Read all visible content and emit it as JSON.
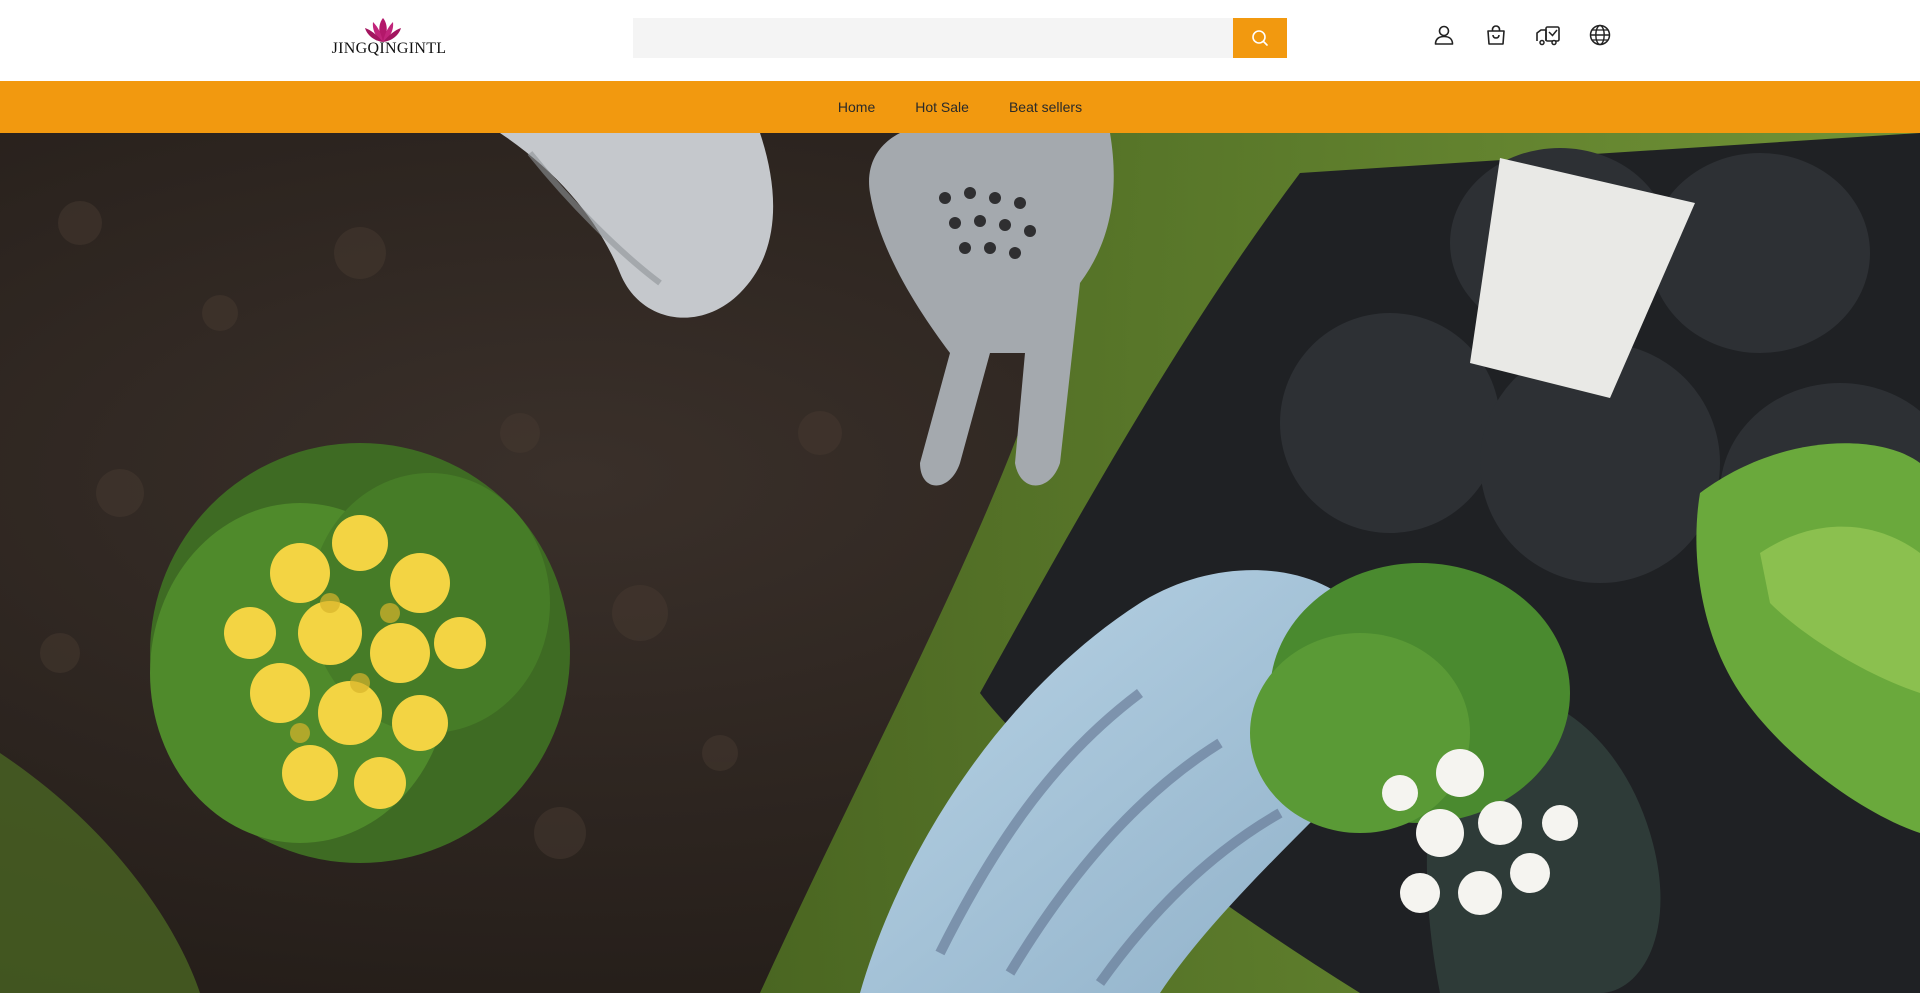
{
  "brand": {
    "logo_text": "JINGQINGINTL",
    "accent_color": "#f2990f",
    "logo_color": "#b3186a"
  },
  "search": {
    "placeholder": "",
    "value": "",
    "button_icon": "search-icon"
  },
  "header_icons": [
    "user-icon",
    "cart-icon",
    "tracking-icon",
    "globe-icon"
  ],
  "nav": {
    "items": [
      {
        "label": "Home"
      },
      {
        "label": "Hot Sale"
      },
      {
        "label": "Beat sellers"
      }
    ]
  },
  "hero": {
    "image_subject": "hero-banner-gardening",
    "dominant_colors": [
      "#2a231f",
      "#5a7d2a",
      "#9bb9d0",
      "#f2d443"
    ]
  }
}
